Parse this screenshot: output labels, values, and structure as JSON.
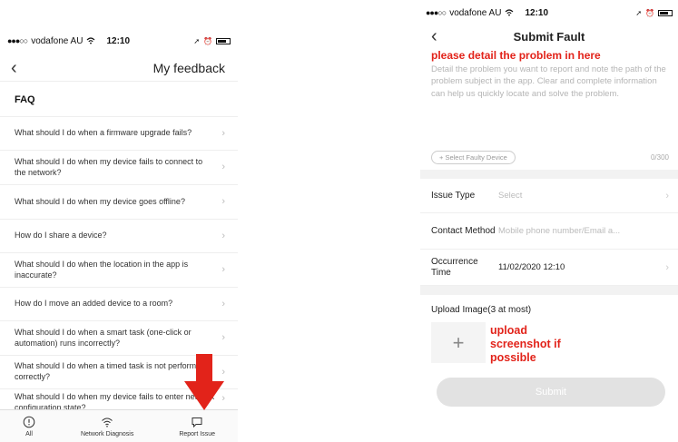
{
  "left_screen": {
    "status_bar": {
      "carrier": "vodafone AU",
      "time": "12:10"
    },
    "nav": {
      "title": "My feedback"
    },
    "faq_heading": "FAQ",
    "faq_items": [
      {
        "text": "What should I do when a firmware upgrade fails?"
      },
      {
        "text": "What should I do when my device fails to connect to the network?"
      },
      {
        "text": "What should I do when my device goes offline?"
      },
      {
        "text": "How do I share a device?"
      },
      {
        "text": "What should I do when the location in the app is inaccurate?"
      },
      {
        "text": "How do I move an added device to a room?"
      },
      {
        "text": "What should I do when a smart task (one-click or automation) runs incorrectly?"
      },
      {
        "text": "What should I do when a timed task is not performed correctly?"
      },
      {
        "text": "What should I do when my device fails to enter network configuration state?"
      }
    ],
    "tabs": [
      {
        "label": "All",
        "icon": "info-circle-icon"
      },
      {
        "label": "Network Diagnosis",
        "icon": "wifi-icon"
      },
      {
        "label": "Report Issue",
        "icon": "chat-bubble-icon"
      }
    ],
    "annotation_color": "#e2231a"
  },
  "right_screen": {
    "status_bar": {
      "carrier": "vodafone AU",
      "time": "12:10"
    },
    "nav": {
      "title": "Submit Fault"
    },
    "annotation_top": "please detail the problem in here",
    "description_placeholder": "Detail the problem you want to report and note the path of the problem subject in the app. Clear and complete information can help us quickly locate and solve the problem.",
    "select_device_label": "+ Select Faulty Device",
    "char_counter": "0/300",
    "form": {
      "issue_type": {
        "label": "Issue Type",
        "value": "Select"
      },
      "contact_method": {
        "label": "Contact Method",
        "value": "Mobile phone number/Email a..."
      },
      "occurrence_time": {
        "label": "Occurrence Time",
        "value": "11/02/2020 12:10"
      }
    },
    "upload_label": "Upload Image(3 at most)",
    "annotation_upload": "upload screenshot if possible",
    "submit_label": "Submit",
    "annotation_color": "#e2231a",
    "submit_disabled_color": "#e2e2e2"
  }
}
